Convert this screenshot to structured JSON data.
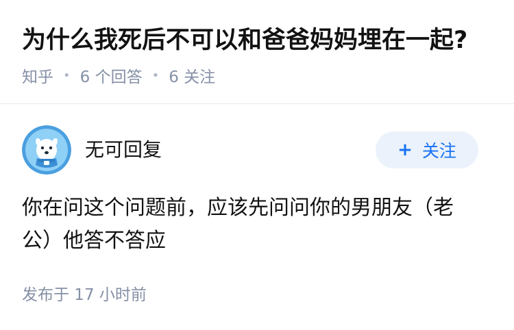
{
  "question": {
    "title": "为什么我死后不可以和爸爸妈妈埋在一起?",
    "source": "知乎",
    "answers_count": "6 个回答",
    "followers_count": "6 关注"
  },
  "answer": {
    "author": {
      "name": "无可回复",
      "avatar_icon": "cartoon-dog-avatar-icon"
    },
    "follow_button": {
      "plus": "+",
      "label": "关注"
    },
    "text": "你在问这个问题前，应该先问问你的男朋友（老公）他答不答应",
    "publish_time": "发布于 17 小时前"
  },
  "colors": {
    "accent": "#1772f6",
    "button_bg": "#ebf2fb",
    "meta_gray": "#8590a6",
    "text": "#121212"
  }
}
